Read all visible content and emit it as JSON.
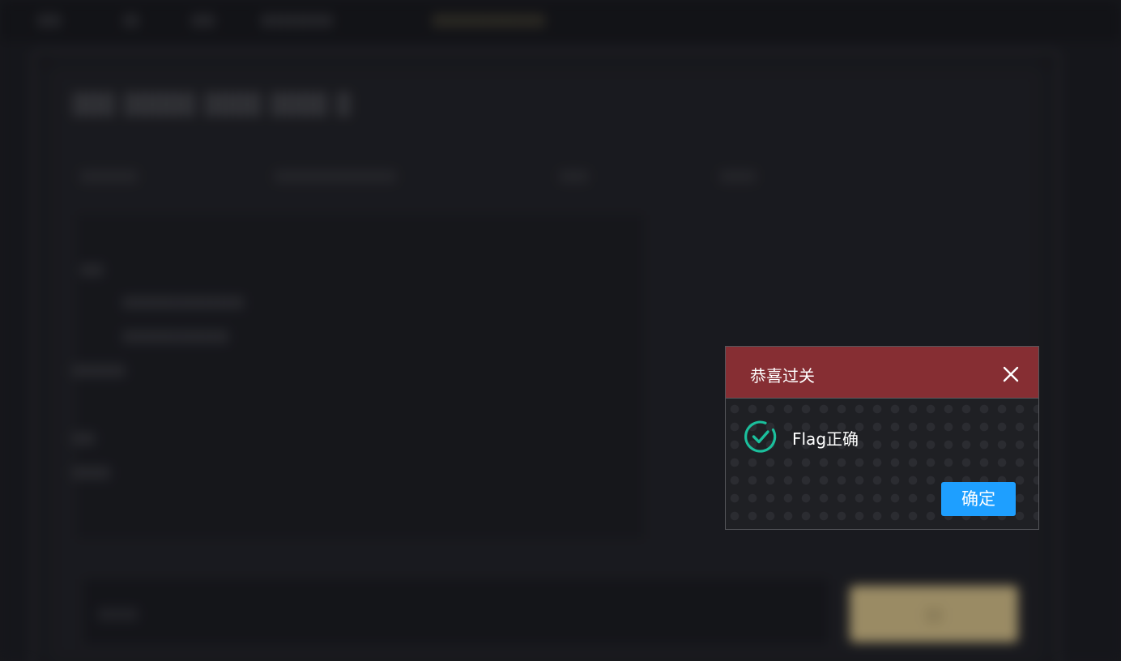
{
  "dialog": {
    "title": "恭喜过关",
    "message": "Flag正确",
    "confirm_label": "确定",
    "header_color": "#862e33",
    "confirm_color": "#1e9fff",
    "success_icon_color": "#1bbf9c",
    "icons": {
      "close": "close-icon",
      "success": "check-circle-icon"
    }
  }
}
